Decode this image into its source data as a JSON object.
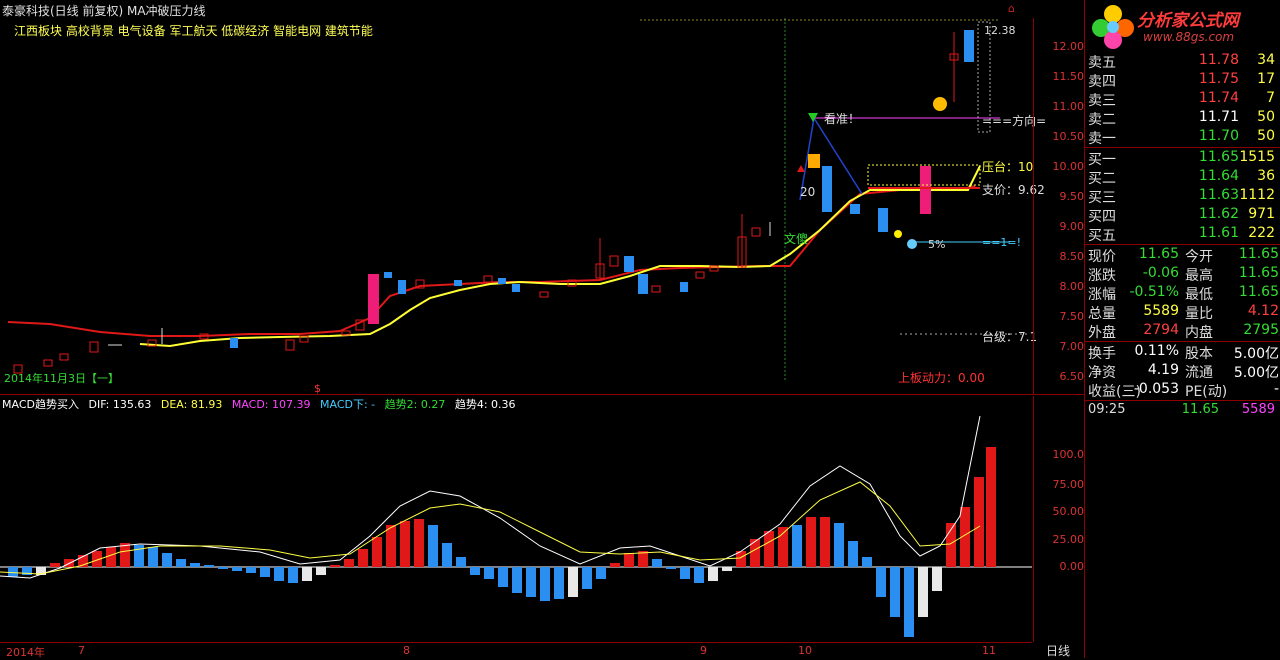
{
  "header": {
    "title": "泰豪科技(日线 前复权) MA冲破压力线",
    "sectors": "江西板块 高校背景 电气设备 军工航天 低碳经济 智能电网 建筑节能"
  },
  "main_chart": {
    "price_ticks": [
      "12.00",
      "11.50",
      "11.00",
      "10.50",
      "10.00",
      "9.50",
      "9.00",
      "8.50",
      "8.00",
      "7.50",
      "7.00",
      "6.50"
    ],
    "labels": {
      "top_price": "12.38",
      "direction": "===方向=",
      "watch": "看准！",
      "pressure": "压台：10",
      "support": "支价：9.62",
      "equal_one": "==1=!",
      "level": "台级：7.1",
      "date_note": "2014年11月3日【一】",
      "limit_power": "上板动力：0.00",
      "num20": "20",
      "wen": "文傻",
      "pct": "5%",
      "dollar": "$"
    }
  },
  "macd_header": {
    "name": "MACD趋势买入",
    "dif": "DIF: 135.63",
    "dea": "DEA: 81.93",
    "macd": "MACD: 107.39",
    "macd_down": "MACD下: -",
    "trend2": "趋势2: 0.27",
    "trend4": "趋势4: 0.36"
  },
  "macd_ticks": [
    "100.0",
    "75.00",
    "50.00",
    "25.00",
    "0.00"
  ],
  "time_axis": [
    "2014年",
    "7",
    "8",
    "9",
    "10",
    "11"
  ],
  "period": "日线",
  "logo": {
    "main": "分析家公式网",
    "sub": "www.88gs.com"
  },
  "order_book": {
    "asks": [
      {
        "label": "卖五",
        "price": "11.78",
        "vol": "34"
      },
      {
        "label": "卖四",
        "price": "11.75",
        "vol": "17"
      },
      {
        "label": "卖三",
        "price": "11.74",
        "vol": "7"
      },
      {
        "label": "卖二",
        "price": "11.71",
        "vol": "50"
      },
      {
        "label": "卖一",
        "price": "11.70",
        "vol": "50"
      }
    ],
    "bids": [
      {
        "label": "买一",
        "price": "11.65",
        "vol": "1515"
      },
      {
        "label": "买二",
        "price": "11.64",
        "vol": "36"
      },
      {
        "label": "买三",
        "price": "11.63",
        "vol": "1112"
      },
      {
        "label": "买四",
        "price": "11.62",
        "vol": "971"
      },
      {
        "label": "买五",
        "price": "11.61",
        "vol": "222"
      }
    ]
  },
  "stats": [
    {
      "l1": "现价",
      "v1": "11.65",
      "l2": "今开",
      "v2": "11.65"
    },
    {
      "l1": "涨跌",
      "v1": "-0.06",
      "l2": "最高",
      "v2": "11.65"
    },
    {
      "l1": "涨幅",
      "v1": "-0.51%",
      "l2": "最低",
      "v2": "11.65"
    },
    {
      "l1": "总量",
      "v1": "5589",
      "l2": "量比",
      "v2": "4.12"
    },
    {
      "l1": "外盘",
      "v1": "2794",
      "l2": "内盘",
      "v2": "2795"
    },
    {
      "l1": "换手",
      "v1": "0.11%",
      "l2": "股本",
      "v2": "5.00亿"
    },
    {
      "l1": "净资",
      "v1": "4.19",
      "l2": "流通",
      "v2": "5.00亿"
    },
    {
      "l1": "收益(三)",
      "v1": "-0.053",
      "l2": "PE(动)",
      "v2": "-"
    }
  ],
  "tick": {
    "time": "09:25",
    "price": "11.65",
    "vol": "5589"
  }
}
